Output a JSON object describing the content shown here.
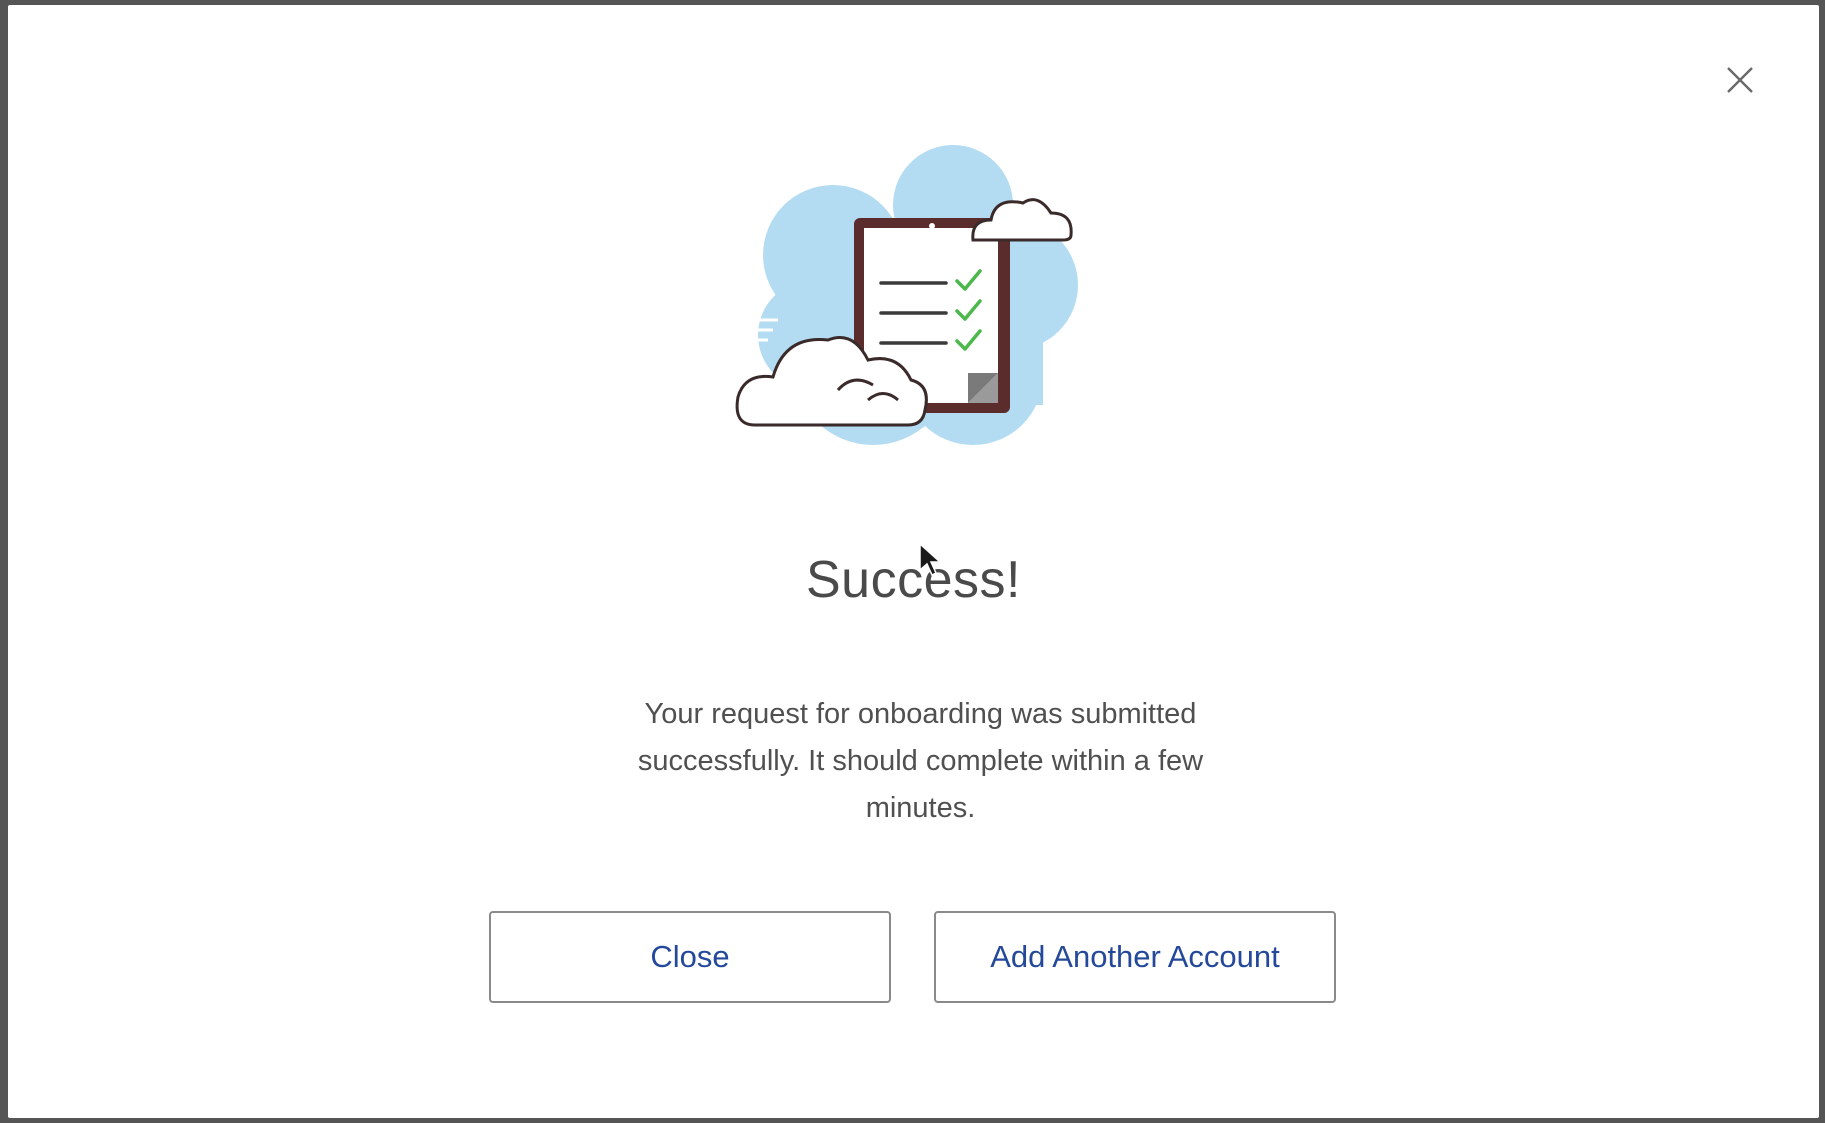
{
  "dialog": {
    "title": "Success!",
    "message": "Your request for onboarding was submitted successfully. It should complete within a few minutes.",
    "close_icon": "close-icon",
    "illustration": "cloud-checklist-illustration"
  },
  "buttons": {
    "close_label": "Close",
    "add_another_label": "Add Another Account"
  },
  "colors": {
    "button_text": "#25499a",
    "title_text": "#4a4a4a",
    "cloud_blue": "#b3dcf3",
    "check_green": "#4cb84c",
    "clipboard_brown": "#5a2c2c"
  }
}
